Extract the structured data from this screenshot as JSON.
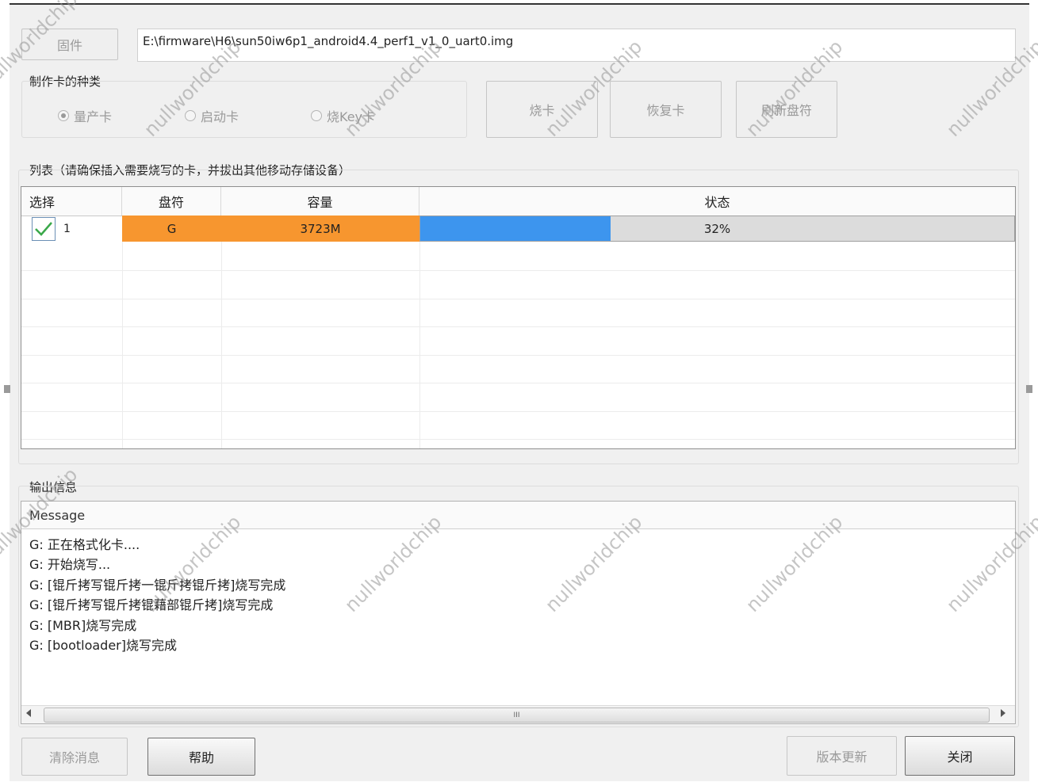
{
  "firmware": {
    "button_label": "固件",
    "path": "E:\\firmware\\H6\\sun50iw6p1_android4.4_perf1_v1_0_uart0.img"
  },
  "card_type": {
    "label": "制作卡的种类",
    "options": [
      {
        "label": "量产卡",
        "selected": true
      },
      {
        "label": "启动卡",
        "selected": false
      },
      {
        "label": "烧Key卡",
        "selected": false
      }
    ]
  },
  "actions": {
    "burn": "烧卡",
    "restore": "恢复卡",
    "refresh": "刷新盘符"
  },
  "list": {
    "label": "列表（请确保插入需要烧写的卡，并拔出其他移动存储设备）",
    "columns": [
      "选择",
      "盘符",
      "容量",
      "状态"
    ],
    "rows": [
      {
        "index": "1",
        "checked": true,
        "drive": "G",
        "capacity": "3723M",
        "progress_text": "32%",
        "progress": 0.32
      }
    ]
  },
  "output": {
    "label": "输出信息",
    "column": "Message",
    "messages": [
      "G: 正在格式化卡....",
      "G: 开始烧写...",
      "G: [锟斤拷写锟斤拷一锟斤拷锟斤拷]烧写完成",
      "G: [锟斤拷写锟斤拷锟藉部锟斤拷]烧写完成",
      "G: [MBR]烧写完成",
      "G: [bootloader]烧写完成"
    ],
    "scroll_grip": "III"
  },
  "footer": {
    "clear": "清除消息",
    "help": "帮助",
    "update": "版本更新",
    "close": "关闭"
  },
  "watermark": "nullworldchip",
  "colors": {
    "highlight": "#f7962f",
    "progress_fill": "#3d95ee",
    "progress_bg": "#dcdcdc"
  }
}
